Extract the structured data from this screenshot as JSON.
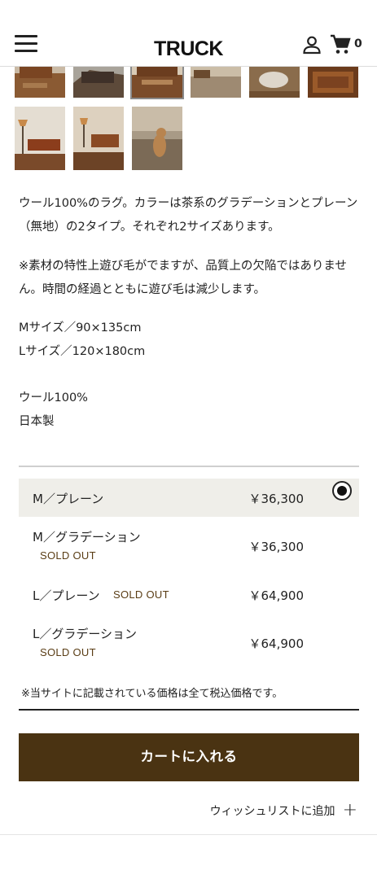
{
  "header": {
    "logo": "TRUCK",
    "cart_count": "0",
    "icons": [
      "hamburger-menu-icon",
      "user-icon",
      "cart-icon"
    ]
  },
  "gallery": {
    "selected_index": 2,
    "thumbnails": [
      "sofa-room-photo",
      "rug-closeup-photo",
      "living-room-photo",
      "rug-room-photo",
      "dog-on-rug-photo",
      "brown-rug-photo",
      "lamp-room-photo",
      "sofa-lamp-photo",
      "cat-on-rug-photo"
    ]
  },
  "description": {
    "p1_line1": "ウール100%のラグ。カラーは茶系のグラデーションとプレーン",
    "p1_line2": "（無地）の2タイプ。それぞれ2サイズあります。",
    "p2_line1": "※素材の特性上遊び毛がでますが、品質上の欠陥ではありませ",
    "p2_line2": "ん。時間の経過とともに遊び毛は減少します。",
    "size_m": "Mサイズ／90×135cm",
    "size_l": "Lサイズ／120×180cm",
    "material": "ウール100%",
    "origin": "日本製"
  },
  "variants": [
    {
      "name": "M／プレーン",
      "price": "￥36,300",
      "soldout": "",
      "selected": true
    },
    {
      "name": "M／グラデーション",
      "price": "￥36,300",
      "soldout": "SOLD OUT",
      "selected": false
    },
    {
      "name": "L／プレーン",
      "price": "￥64,900",
      "soldout": "SOLD OUT",
      "selected": false
    },
    {
      "name": "L／グラデーション",
      "price": "￥64,900",
      "soldout": "SOLD OUT",
      "selected": false
    }
  ],
  "tax_note": "※当サイトに記載されている価格は全て税込価格です。",
  "add_to_cart": "カートに入れる",
  "wishlist": "ウィッシュリストに追加",
  "colors": {
    "accent_brown": "#4a3312",
    "soldout_text": "#5a3d15",
    "selected_row_bg": "#efeee9"
  }
}
